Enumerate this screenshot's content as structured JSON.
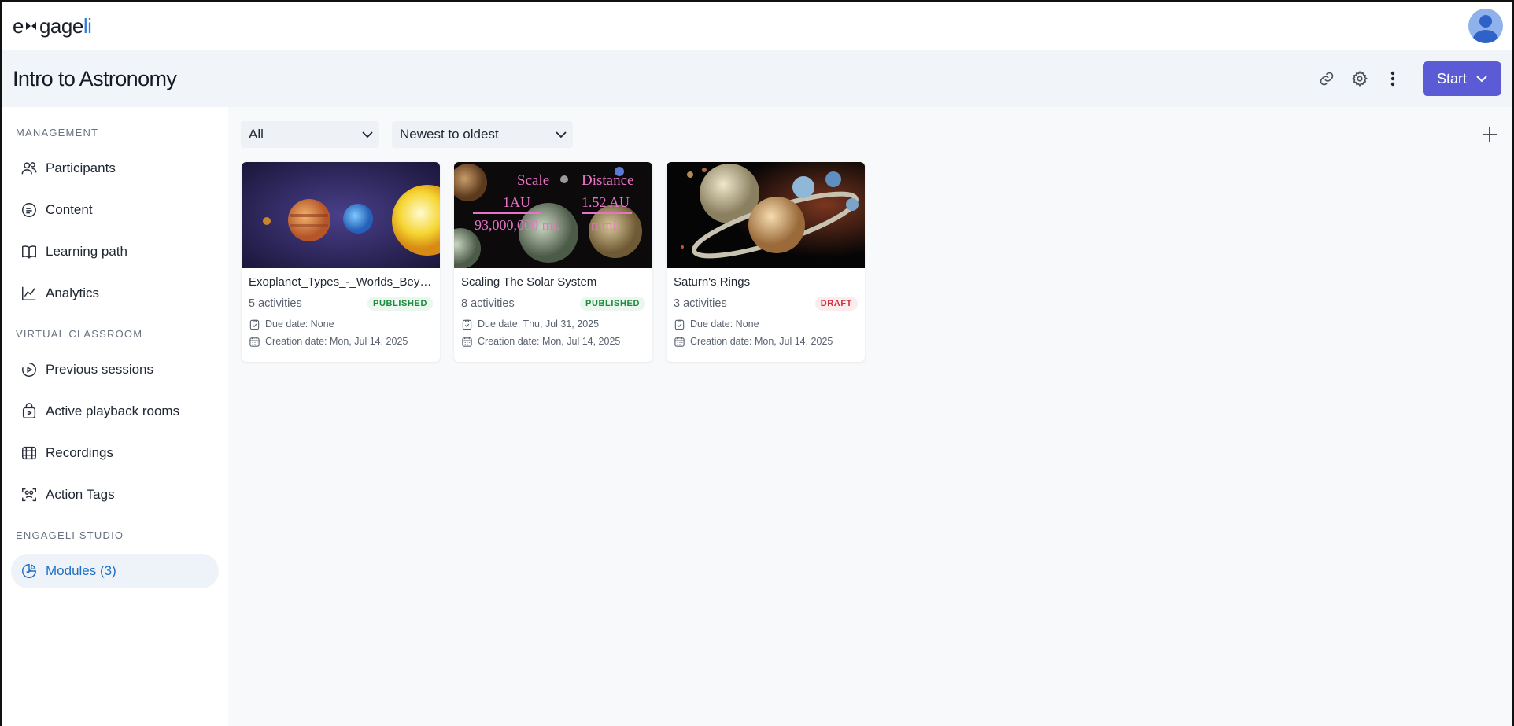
{
  "app": {
    "logo_main": "e",
    "logo_mid": "gage",
    "logo_accent": "li"
  },
  "header": {
    "title": "Intro to Astronomy",
    "start_label": "Start"
  },
  "sidebar": {
    "sections": [
      {
        "label": "MANAGEMENT"
      },
      {
        "label": "VIRTUAL CLASSROOM"
      },
      {
        "label": "ENGAGELI STUDIO"
      }
    ],
    "items": [
      {
        "label": "Participants",
        "icon": "participants-icon"
      },
      {
        "label": "Content",
        "icon": "content-icon"
      },
      {
        "label": "Learning path",
        "icon": "book-icon"
      },
      {
        "label": "Analytics",
        "icon": "analytics-icon"
      },
      {
        "label": "Previous sessions",
        "icon": "sessions-icon"
      },
      {
        "label": "Active playback rooms",
        "icon": "playback-icon"
      },
      {
        "label": "Recordings",
        "icon": "film-icon"
      },
      {
        "label": "Action Tags",
        "icon": "tags-icon"
      },
      {
        "label": "Modules (3)",
        "icon": "modules-icon",
        "active": true
      }
    ]
  },
  "filters": {
    "type_value": "All",
    "sort_value": "Newest to oldest"
  },
  "modules": [
    {
      "title": "Exoplanet_Types_-_Worlds_Beyo...",
      "activities": "5 activities",
      "status": "PUBLISHED",
      "due": "Due date: None",
      "created": "Creation date: Mon, Jul 14, 2025"
    },
    {
      "title": "Scaling The Solar System",
      "activities": "8 activities",
      "status": "PUBLISHED",
      "due": "Due date: Thu, Jul 31, 2025",
      "created": "Creation date: Mon, Jul 14, 2025",
      "thumb_text": {
        "scale": "Scale",
        "au": "1AU",
        "miles": "93,000,000 mi.",
        "distance": "Distance",
        "au2": "1.52 AU",
        "nmi": "n mi."
      }
    },
    {
      "title": "Saturn's Rings",
      "activities": "3 activities",
      "status": "DRAFT",
      "due": "Due date: None",
      "created": "Creation date: Mon, Jul 14, 2025"
    }
  ],
  "colors": {
    "accent": "#5b5bd6",
    "active_nav": "#1f6fc4",
    "published": "#1a8a3c",
    "draft": "#d12f3c"
  }
}
